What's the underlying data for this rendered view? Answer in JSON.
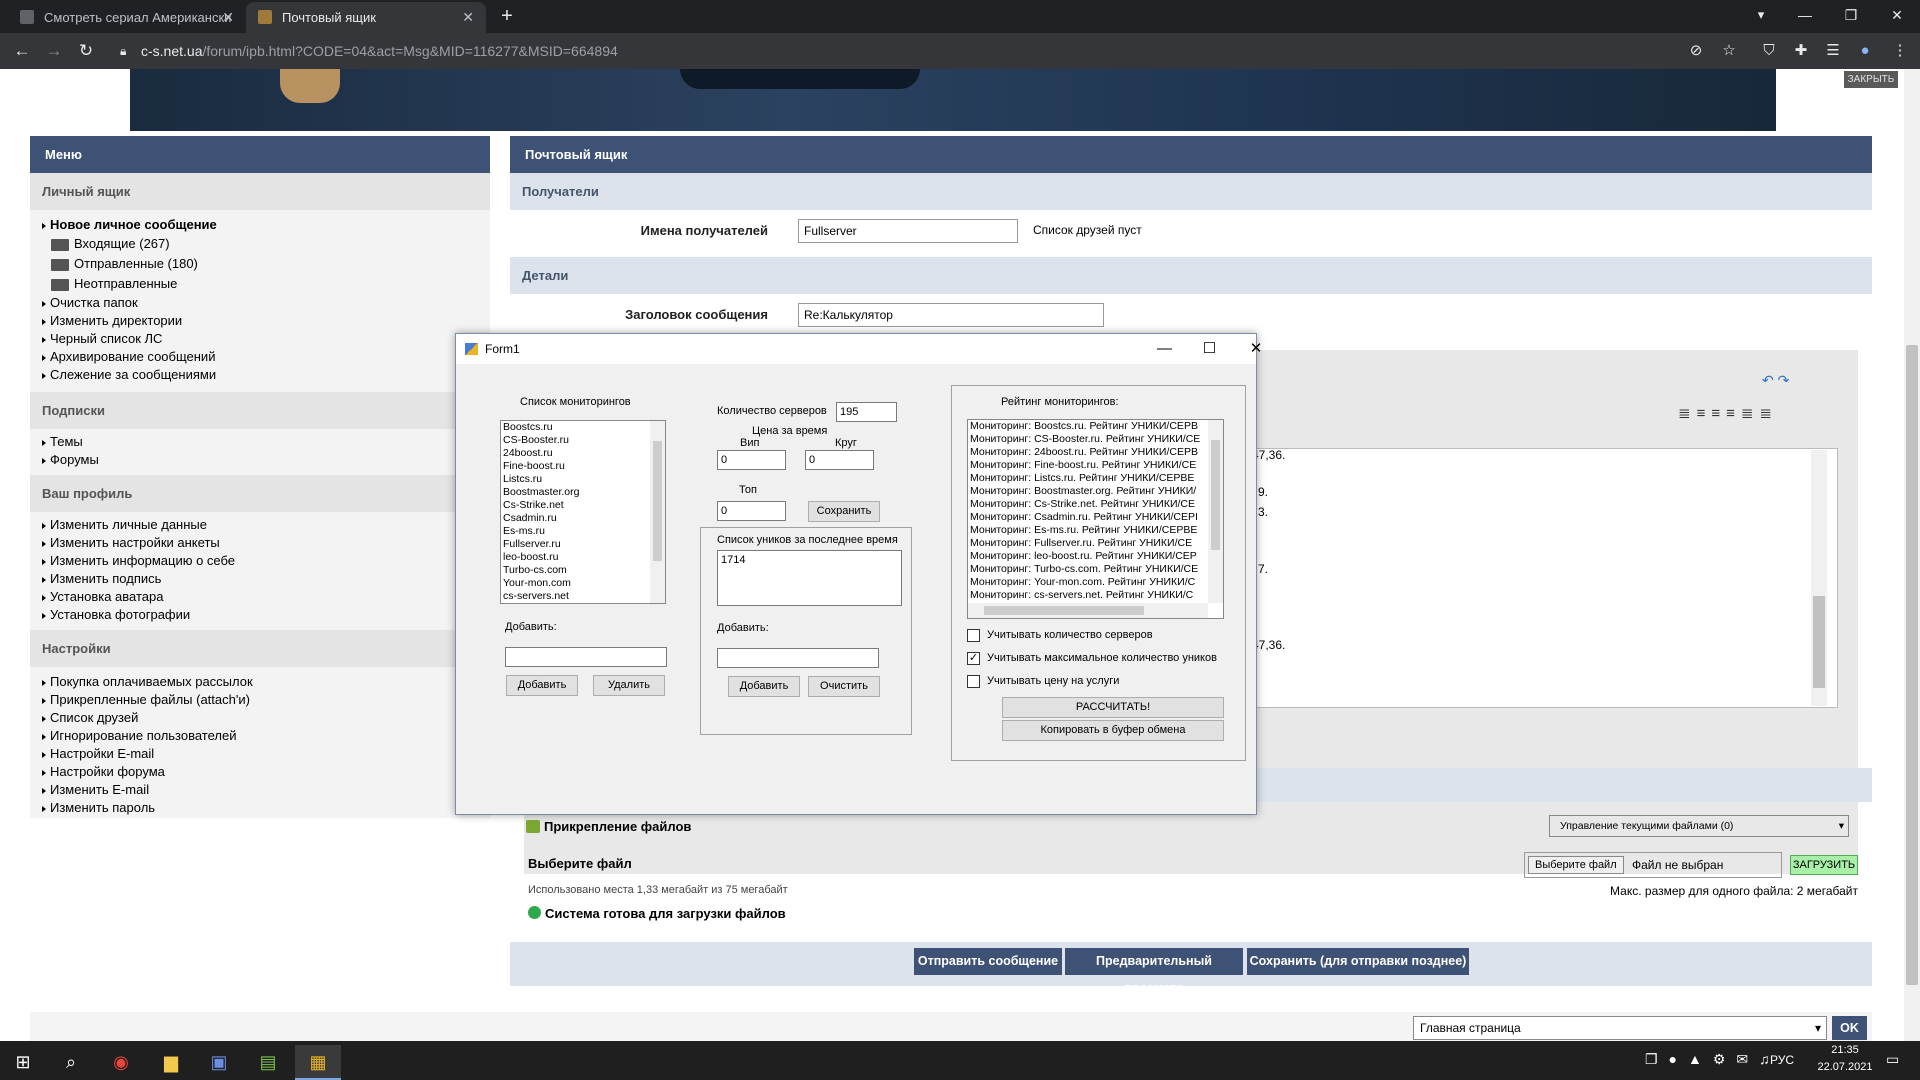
{
  "browser": {
    "tabs": [
      {
        "label": "Смотреть сериал Американски"
      },
      {
        "label": "Почтовый ящик"
      }
    ],
    "url_host": "c-s.net.ua",
    "url_path": "/forum/ipb.html?CODE=04&act=Msg&MID=116277&MSID=664894",
    "close_ad": "ЗАКРЫТЬ"
  },
  "sidebar": {
    "menu_title": "Меню",
    "sections": [
      {
        "title": "Личный ящик"
      },
      {
        "title": "Подписки"
      },
      {
        "title": "Ваш профиль"
      },
      {
        "title": "Настройки"
      }
    ],
    "new_message": "Новое личное сообщение",
    "folders": [
      "Входящие (267)",
      "Отправленные (180)",
      "Неотправленные"
    ],
    "mail_items": [
      "Очистка папок",
      "Изменить директории",
      "Черный список ЛС",
      "Архивирование сообщений",
      "Слежение за сообщениями"
    ],
    "subscriptions": [
      "Темы",
      "Форумы"
    ],
    "profile": [
      "Изменить личные данные",
      "Изменить настройки анкеты",
      "Изменить информацию о себе",
      "Изменить подпись",
      "Установка аватара",
      "Установка фотографии"
    ],
    "settings": [
      "Покупка оплачиваемых рассылок",
      "Прикрепленные файлы (attach'и)",
      "Список друзей",
      "Игнорирование пользователей",
      "Настройки E-mail",
      "Настройки форума",
      "Изменить E-mail",
      "Изменить пароль"
    ]
  },
  "main": {
    "title": "Почтовый ящик",
    "recipients_head": "Получатели",
    "recipients_label": "Имена получателей",
    "recipients_value": "Fullserver",
    "friends_note": "Список друзей пуст",
    "details_head": "Детали",
    "subject_label": "Заголовок сообщения",
    "subject_value": "Re:Калькулятор",
    "editor_fragments": [
      "47,36.",
      "9.",
      "3.",
      "7.",
      "47,36."
    ],
    "attach_title": "Прикрепление файлов",
    "manage_files": "Управление текущими файлами (0)",
    "choose_file": "Выберите файл",
    "usage": "Использовано места 1,33 мегабайт из 75 мегабайт",
    "ready": "Система готова для загрузки файлов",
    "file_button": "Выберите файл",
    "file_none": "Файл не выбран",
    "upload": "ЗАГРУЗИТЬ",
    "max_size": "Макс. размер для одного файла: 2 мегабайт",
    "send": "Отправить сообщение",
    "preview": "Предварительный просмотр",
    "save_later": "Сохранить (для отправки позднее)",
    "jump_select": "Главная страница",
    "ok": "OK"
  },
  "form1": {
    "title": "Form1",
    "monitor_list_label": "Список мониторингов",
    "monitors": [
      "Boostcs.ru",
      "CS-Booster.ru",
      "24boost.ru",
      "Fine-boost.ru",
      "Listcs.ru",
      "Boostmaster.org",
      "Cs-Strike.net",
      "Csadmin.ru",
      "Es-ms.ru",
      "Fullserver.ru",
      "leo-boost.ru",
      "Turbo-cs.com",
      "Your-mon.com",
      "cs-servers.net"
    ],
    "add_label": "Добавить:",
    "add_btn": "Добавить",
    "del_btn": "Удалить",
    "servers_count_label": "Количество серверов",
    "servers_count": "195",
    "price_label": "Цена за время",
    "vip_label": "Вип",
    "vip_value": "0",
    "circle_label": "Круг",
    "circle_value": "0",
    "top_label": "Топ",
    "top_value": "0",
    "save_btn": "Сохранить",
    "uniques_label": "Список уников за последнее время",
    "uniques_value": "1714",
    "add2_label": "Добавить:",
    "add2_btn": "Добавить",
    "clear_btn": "Очистить",
    "rating_label": "Рейтинг мониторингов:",
    "rating": [
      "Мониторинг: Boostcs.ru. Рейтинг УНИКИ/СЕРВ",
      "Мониторинг: CS-Booster.ru. Рейтинг УНИКИ/СЕ",
      "Мониторинг: 24boost.ru. Рейтинг УНИКИ/СЕРВ",
      "Мониторинг: Fine-boost.ru. Рейтинг УНИКИ/СЕ",
      "Мониторинг: Listcs.ru. Рейтинг УНИКИ/СЕРВЕ",
      "Мониторинг: Boostmaster.org. Рейтинг УНИКИ/",
      "Мониторинг: Cs-Strike.net. Рейтинг УНИКИ/СЕ",
      "Мониторинг: Csadmin.ru. Рейтинг УНИКИ/СЕРІ",
      "Мониторинг: Es-ms.ru. Рейтинг УНИКИ/СЕРВЕ",
      "Мониторинг: Fullserver.ru. Рейтинг УНИКИ/СЕ",
      "Мониторинг: leo-boost.ru. Рейтинг УНИКИ/СЕР",
      "Мониторинг: Turbo-cs.com. Рейтинг УНИКИ/СЕ",
      "Мониторинг: Your-mon.com. Рейтинг УНИКИ/С",
      "Мониторинг: cs-servers.net. Рейтинг УНИКИ/С"
    ],
    "opt1": "Учитывать количество серверов",
    "opt2": "Учитывать максимальное количество уников",
    "opt3": "Учитывать цену на услуги",
    "opt2_checked": true,
    "calc_btn": "РАССЧИТАТЬ!",
    "copy_btn": "Копировать в буфер обмена"
  },
  "taskbar": {
    "lang": "РУС",
    "time": "21:35",
    "date": "22.07.2021"
  }
}
